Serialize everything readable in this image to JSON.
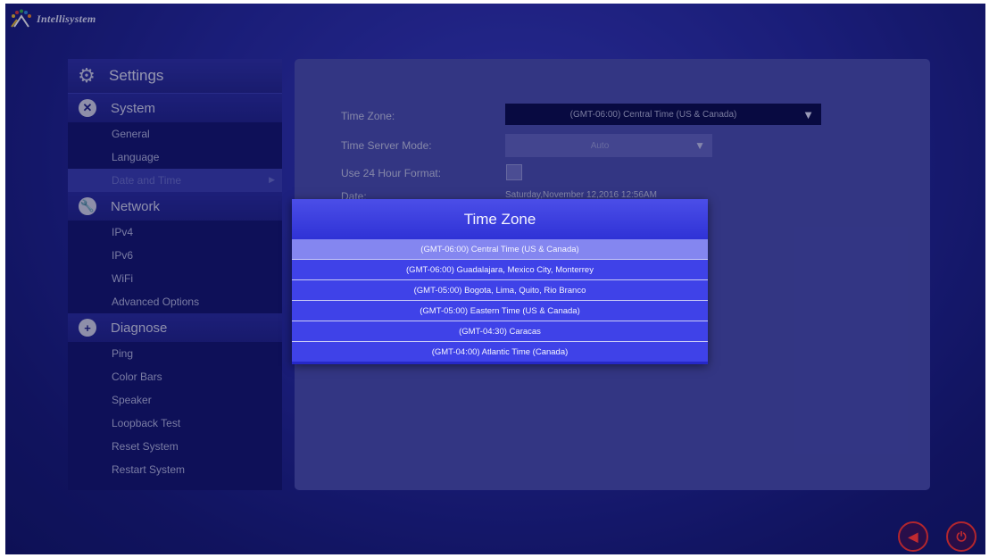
{
  "app": {
    "brand": "Intellisystem"
  },
  "sidebar": {
    "header": {
      "label": "Settings",
      "icon": "gear-icon"
    },
    "sections": [
      {
        "label": "System",
        "icon": "tools-icon",
        "items": [
          {
            "label": "General"
          },
          {
            "label": "Language"
          },
          {
            "label": "Date and Time",
            "active": true
          }
        ]
      },
      {
        "label": "Network",
        "icon": "wrench-icon",
        "items": [
          {
            "label": "IPv4"
          },
          {
            "label": "IPv6"
          },
          {
            "label": "WiFi"
          },
          {
            "label": "Advanced Options"
          }
        ]
      },
      {
        "label": "Diagnose",
        "icon": "plus-icon",
        "items": [
          {
            "label": "Ping"
          },
          {
            "label": "Color Bars"
          },
          {
            "label": "Speaker"
          },
          {
            "label": "Loopback Test"
          },
          {
            "label": "Reset System"
          },
          {
            "label": "Restart System"
          }
        ]
      }
    ]
  },
  "form": {
    "time_zone_label": "Time Zone:",
    "time_zone_value": "(GMT-06:00) Central Time (US & Canada)",
    "server_mode_label": "Time Server Mode:",
    "server_mode_value": "Auto",
    "format_label": "Use 24 Hour Format:",
    "format_checked": false,
    "date_label": "Date:",
    "date_value": "Saturday,November 12,2016 12:56AM"
  },
  "modal": {
    "title": "Time Zone",
    "options": [
      "(GMT-06:00) Central Time (US & Canada)",
      "(GMT-06:00) Guadalajara, Mexico City, Monterrey",
      "(GMT-05:00) Bogota, Lima, Quito, Rio Branco",
      "(GMT-05:00) Eastern Time (US & Canada)",
      "(GMT-04:30) Caracas",
      "(GMT-04:00) Atlantic Time (Canada)"
    ],
    "selected_index": 0
  },
  "colors": {
    "accent": "#3f42e8",
    "selected": "#8486f0",
    "alert": "#b2262e"
  }
}
